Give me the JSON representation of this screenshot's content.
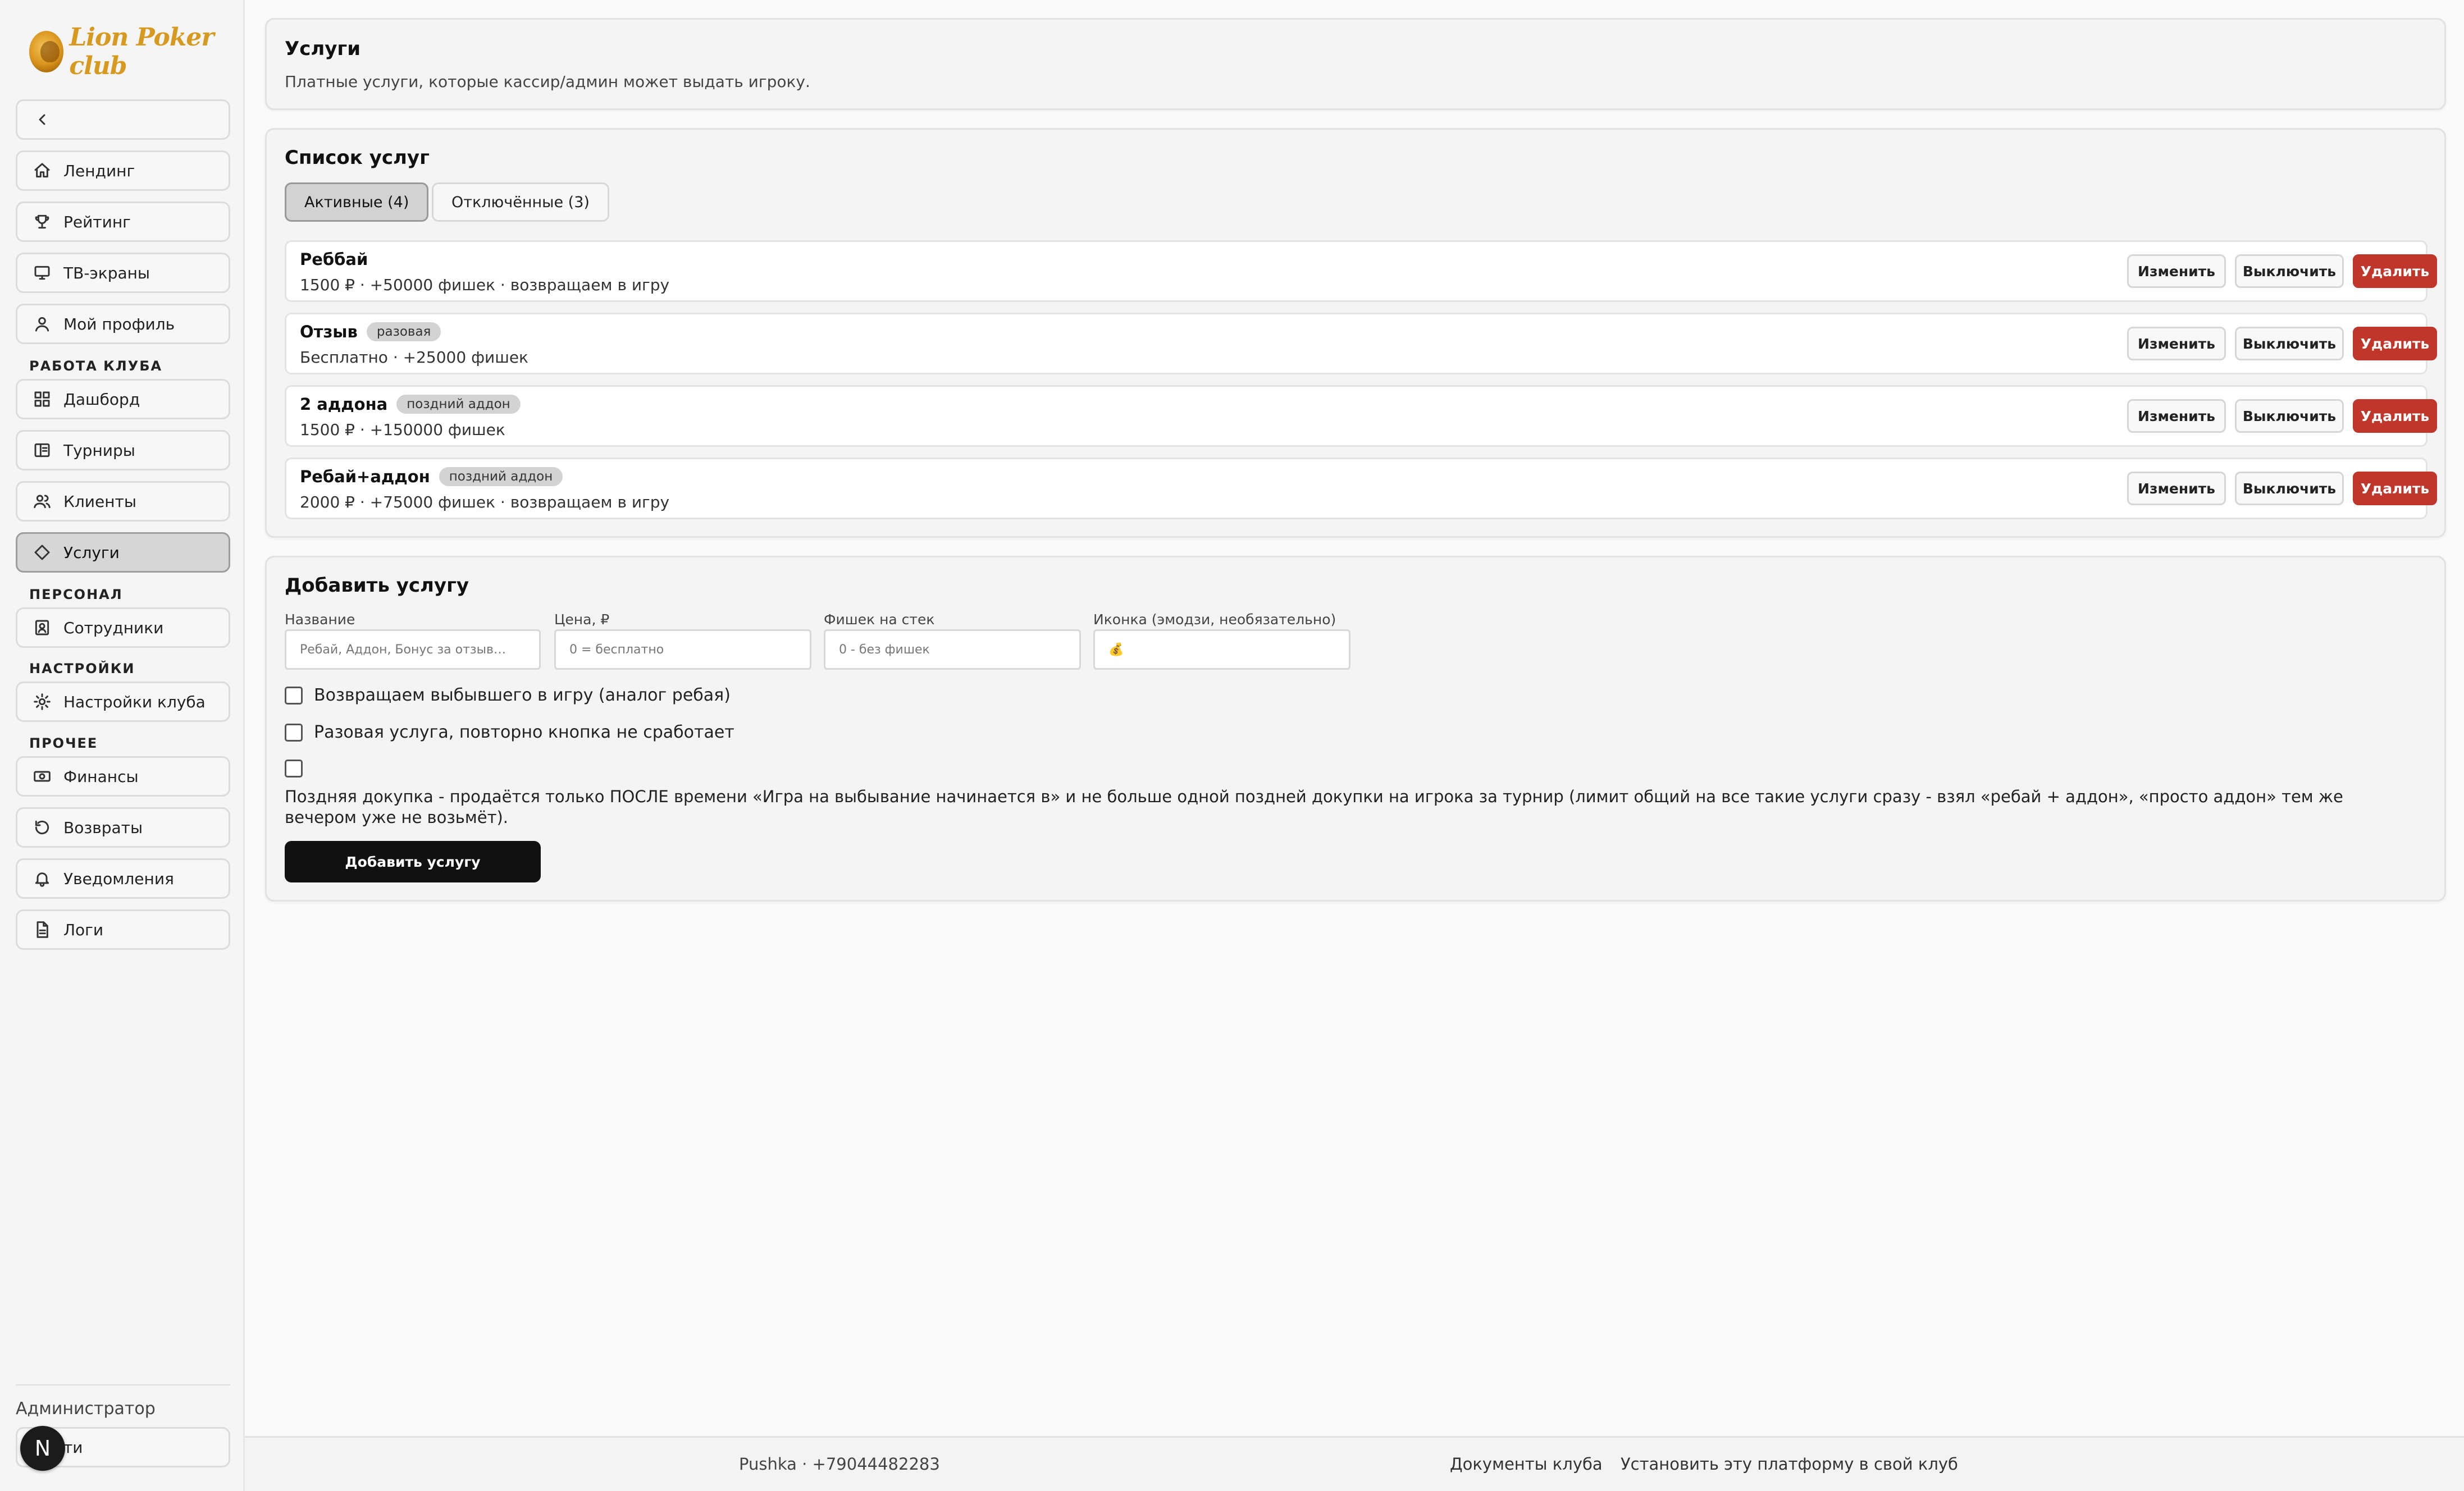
{
  "brand": {
    "logo_text": "Lion Poker club"
  },
  "sidebar": {
    "collapse_icon": "chevron-left-icon",
    "top_items": [
      {
        "label": "Лендинг",
        "icon": "home-icon"
      },
      {
        "label": "Рейтинг",
        "icon": "trophy-icon"
      },
      {
        "label": "ТВ-экраны",
        "icon": "monitor-icon"
      },
      {
        "label": "Мой профиль",
        "icon": "user-icon"
      }
    ],
    "sections": [
      {
        "title": "РАБОТА КЛУБА",
        "items": [
          {
            "label": "Дашборд",
            "icon": "grid-icon"
          },
          {
            "label": "Турниры",
            "icon": "book-icon"
          },
          {
            "label": "Клиенты",
            "icon": "users-icon"
          },
          {
            "label": "Услуги",
            "icon": "diamond-icon",
            "active": true
          }
        ]
      },
      {
        "title": "ПЕРСОНАЛ",
        "items": [
          {
            "label": "Сотрудники",
            "icon": "badge-icon"
          }
        ]
      },
      {
        "title": "НАСТРОЙКИ",
        "items": [
          {
            "label": "Настройки клуба",
            "icon": "sun-gear-icon"
          }
        ]
      },
      {
        "title": "ПРОЧЕЕ",
        "items": [
          {
            "label": "Финансы",
            "icon": "cash-icon"
          },
          {
            "label": "Возвраты",
            "icon": "refresh-icon"
          },
          {
            "label": "Уведомления",
            "icon": "bell-icon"
          },
          {
            "label": "Логи",
            "icon": "file-icon"
          }
        ]
      }
    ],
    "role": "Администратор",
    "logout_label": "ти",
    "avatar_letter": "N"
  },
  "header": {
    "title": "Услуги",
    "subtitle": "Платные услуги, которые кассир/админ может выдать игроку."
  },
  "services": {
    "title": "Список услуг",
    "tabs": [
      {
        "label": "Активные (4)",
        "active": true
      },
      {
        "label": "Отключённые (3)",
        "active": false
      }
    ],
    "items": [
      {
        "name": "Реббай",
        "badge": "",
        "meta": "1500 ₽ · +50000 фишек · возвращаем в игру"
      },
      {
        "name": "Отзыв",
        "badge": "разовая",
        "meta": "Бесплатно · +25000 фишек"
      },
      {
        "name": "2 аддона",
        "badge": "поздний аддон",
        "meta": "1500 ₽ · +150000 фишек"
      },
      {
        "name": "Ребай+аддон",
        "badge": "поздний аддон",
        "meta": "2000 ₽ · +75000 фишек · возвращаем в игру"
      }
    ],
    "btn_edit": "Изменить",
    "btn_disable": "Выключить",
    "btn_delete": "Удалить"
  },
  "add_form": {
    "title": "Добавить услугу",
    "fields": {
      "name": {
        "label": "Название",
        "placeholder": "Ребай, Аддон, Бонус за отзыв…"
      },
      "price": {
        "label": "Цена, ₽",
        "placeholder": "0 = бесплатно"
      },
      "chips": {
        "label": "Фишек на стек",
        "placeholder": "0 - без фишек"
      },
      "icon": {
        "label": "Иконка (эмодзи, необязательно)",
        "value": "💰"
      }
    },
    "checkbox_return": "Возвращаем выбывшего в игру (аналог ребая)",
    "checkbox_once": "Разовая услуга, повторно кнопка не сработает",
    "late_text": "Поздняя докупка - продаётся только ПОСЛЕ времени «Игра на выбывание начинается в» и не больше одной поздней докупки на игрока за турнир (лимит общий на все такие услуги сразу - взял «ребай + аддон», «просто аддон» тем же вечером уже не возьмёт).",
    "submit_label": "Добавить услугу"
  },
  "footer": {
    "contact": "Pushka · +79044482283",
    "link_docs": "Документы клуба",
    "link_install": "Установить эту платформу в свой клуб"
  }
}
